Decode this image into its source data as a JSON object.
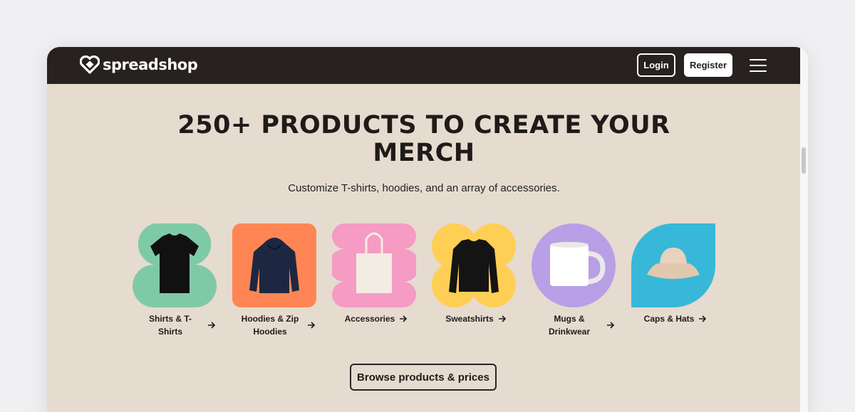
{
  "brand": {
    "logo_text": "spreadshop"
  },
  "nav": {
    "login_label": "Login",
    "register_label": "Register",
    "menu_icon": "hamburger-menu-icon"
  },
  "hero": {
    "title": "250+ PRODUCTS TO CREATE YOUR MERCH",
    "subtitle": "Customize T-shirts, hoodies, and an array of accessories."
  },
  "categories": [
    {
      "label": "Shirts & T-Shirts",
      "icon": "tshirt-icon",
      "bg": "#7fcaa6"
    },
    {
      "label": "Hoodies & Zip Hoodies",
      "icon": "hoodie-icon",
      "bg": "#ff8654"
    },
    {
      "label": "Accessories",
      "icon": "tote-bag-icon",
      "bg": "#f59bc4"
    },
    {
      "label": "Sweatshirts",
      "icon": "sweatshirt-icon",
      "bg": "#ffcf55"
    },
    {
      "label": "Mugs & Drinkwear",
      "icon": "mug-icon",
      "bg": "#b89fe6"
    },
    {
      "label": "Caps & Hats",
      "icon": "bucket-hat-icon",
      "bg": "#38b8d8"
    }
  ],
  "cta": {
    "browse_label": "Browse products & prices"
  },
  "colors": {
    "navbar": "#272220",
    "hero_bg": "#e6dbcf",
    "text_dark": "#1f1b19"
  }
}
